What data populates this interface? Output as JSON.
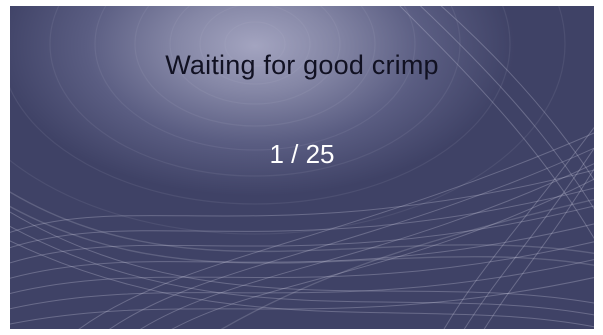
{
  "screen": {
    "status_message": "Waiting for good crimp",
    "progress": {
      "current": 1,
      "total": 25,
      "text": "1 / 25"
    }
  },
  "colors": {
    "background_dark": "#3f4266",
    "background_mid": "#5a5d82",
    "background_glow": "#a3a4c0",
    "message_text": "#111122",
    "counter_text": "#ffffff"
  }
}
